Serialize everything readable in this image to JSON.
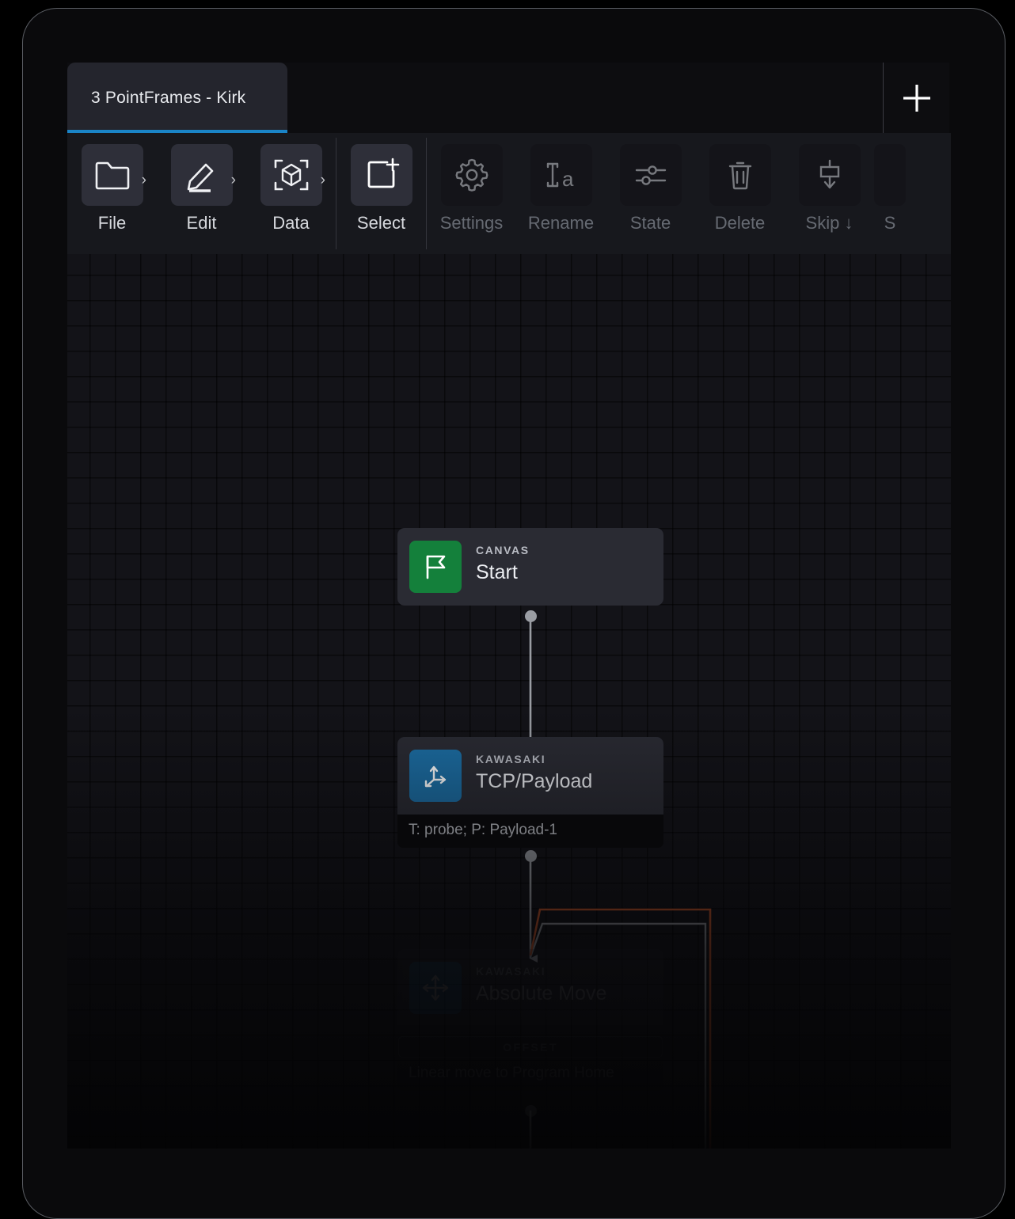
{
  "window": {
    "tab": {
      "label": "3 PointFrames - Kirk",
      "accent": "#1a84c7"
    },
    "add_tab_label": "+"
  },
  "toolbar": {
    "items": [
      {
        "id": "file",
        "label": "File",
        "icon": "folder-icon",
        "has_chevron": true,
        "raised": true,
        "disabled": false
      },
      {
        "id": "edit",
        "label": "Edit",
        "icon": "pencil-icon",
        "has_chevron": true,
        "raised": true,
        "disabled": false
      },
      {
        "id": "data",
        "label": "Data",
        "icon": "cube-scan-icon",
        "has_chevron": true,
        "raised": true,
        "disabled": false
      },
      {
        "id": "select",
        "label": "Select",
        "icon": "select-plus-icon",
        "has_chevron": false,
        "raised": true,
        "disabled": false
      },
      {
        "id": "settings",
        "label": "Settings",
        "icon": "gear-icon",
        "has_chevron": false,
        "raised": false,
        "disabled": true
      },
      {
        "id": "rename",
        "label": "Rename",
        "icon": "rename-text-icon",
        "has_chevron": false,
        "raised": false,
        "disabled": true
      },
      {
        "id": "state",
        "label": "State",
        "icon": "sliders-icon",
        "has_chevron": false,
        "raised": false,
        "disabled": true
      },
      {
        "id": "delete",
        "label": "Delete",
        "icon": "trash-icon",
        "has_chevron": false,
        "raised": false,
        "disabled": true
      },
      {
        "id": "skip",
        "label": "Skip ↓",
        "icon": "skip-down-icon",
        "has_chevron": false,
        "raised": false,
        "disabled": true
      },
      {
        "id": "more",
        "label": "S",
        "icon": "cut-off-icon",
        "has_chevron": false,
        "raised": false,
        "disabled": true
      }
    ]
  },
  "canvas": {
    "grid_size": 32,
    "background": "#131318",
    "nodes": [
      {
        "id": "start",
        "kicker": "CANVAS",
        "title": "Start",
        "icon": "flag-icon",
        "icon_color": "#14803b",
        "footer": null,
        "chip": null,
        "dim": false
      },
      {
        "id": "tcp-payload",
        "kicker": "KAWASAKI",
        "title": "TCP/Payload",
        "icon": "axes-icon",
        "icon_color": "#1c6ea4",
        "footer": "T: probe; P: Payload-1",
        "chip": null,
        "dim": false
      },
      {
        "id": "absolute-move",
        "kicker": "KAWASAKI",
        "title": "Absolute Move",
        "icon": "move-arrows-icon",
        "icon_color": "#1c6ea4",
        "footer": "Linear move to Program Home",
        "chip": "OFFSET",
        "dim": true
      }
    ],
    "edges": [
      {
        "id": "start-to-tcp",
        "color": "#9a9da3",
        "style": "straight"
      },
      {
        "id": "tcp-to-absmove",
        "color": "#9a9da3",
        "style": "straight"
      },
      {
        "id": "loopback-gray",
        "color": "#8e9196",
        "style": "routed"
      },
      {
        "id": "loopback-orange",
        "color": "#c2552b",
        "style": "routed"
      },
      {
        "id": "absmove-out",
        "color": "#9a9da3",
        "style": "straight"
      }
    ]
  }
}
